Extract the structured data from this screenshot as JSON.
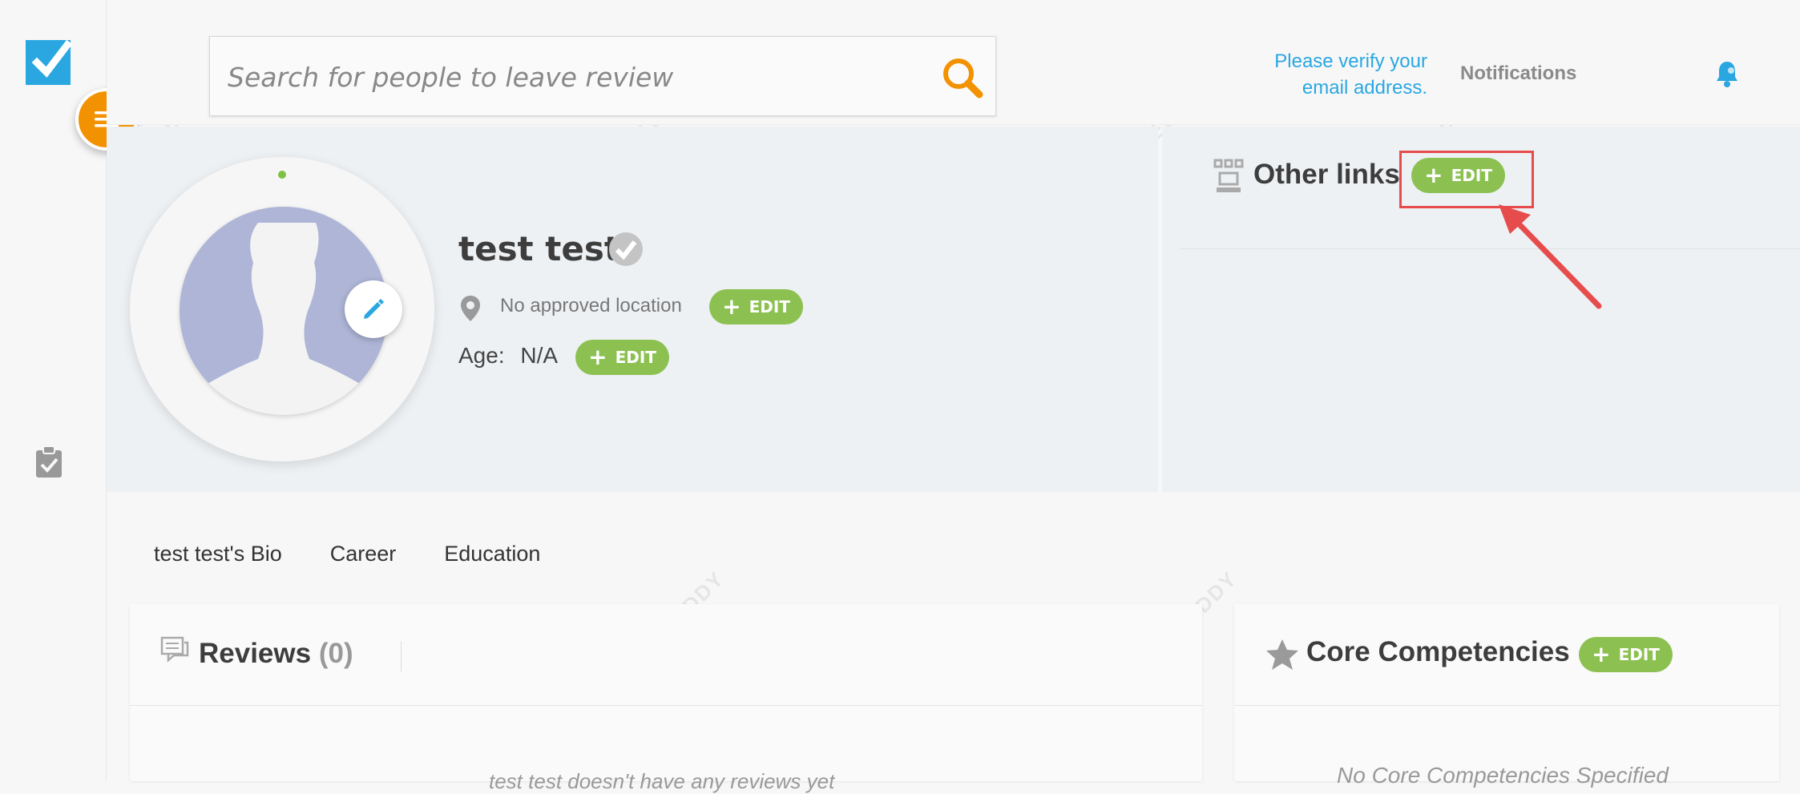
{
  "header": {
    "search_placeholder": "Search for people to leave review",
    "verify_line1": "Please verify your",
    "verify_line2": "email address.",
    "notifications_label": "Notifications"
  },
  "profile": {
    "name": "test test",
    "location_text": "No approved location",
    "age_label": "Age:",
    "age_value": "N/A",
    "edit_label": "EDIT"
  },
  "other_links": {
    "title": "Other links",
    "edit_label": "EDIT"
  },
  "tabs": [
    {
      "label": "test test's Bio"
    },
    {
      "label": "Career"
    },
    {
      "label": "Education"
    }
  ],
  "reviews": {
    "title": "Reviews",
    "count": "(0)",
    "empty_text": "test test doesn't have any reviews yet"
  },
  "core_competencies": {
    "title": "Core Competencies",
    "edit_label": "EDIT",
    "empty_text": "No Core Competencies Specified"
  },
  "watermark": {
    "text": "SEOBUDDY"
  },
  "colors": {
    "accent_green": "#8cc152",
    "menu_orange": "#f39200",
    "link_blue": "#2aa7e1",
    "annotation_red": "#e74c4c"
  }
}
